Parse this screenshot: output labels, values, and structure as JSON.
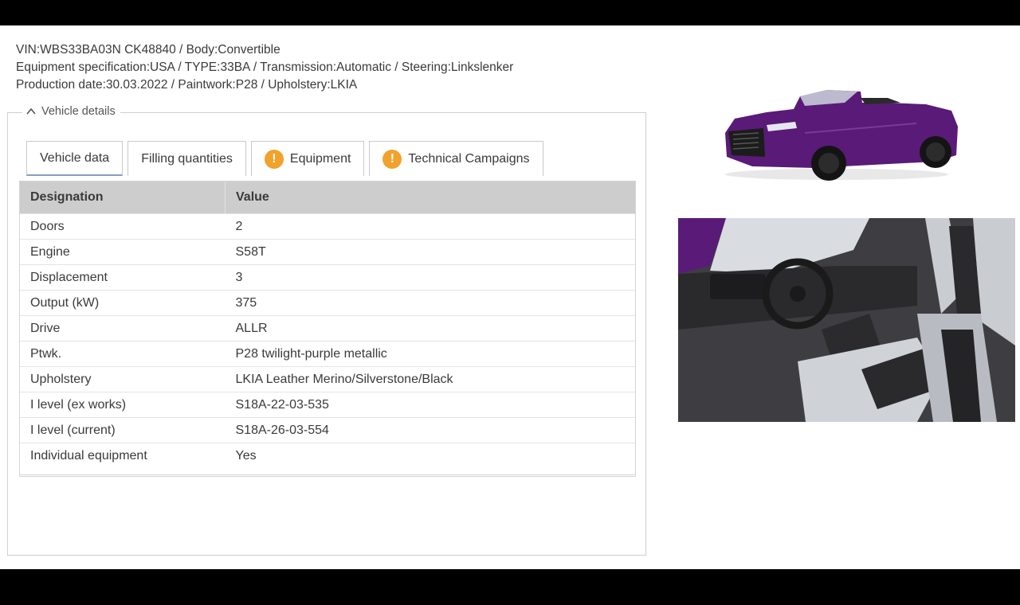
{
  "header": {
    "line1": "VIN:WBS33BA03N CK48840 / Body:Convertible",
    "line2": "Equipment specification:USA / TYPE:33BA / Transmission:Automatic / Steering:Linkslenker",
    "line3": "Production date:30.03.2022 / Paintwork:P28 / Upholstery:LKIA"
  },
  "section": {
    "title": "Vehicle details"
  },
  "tabs": [
    {
      "label": "Vehicle data",
      "warning": false,
      "active": true
    },
    {
      "label": "Filling quantities",
      "warning": false,
      "active": false
    },
    {
      "label": "Equipment",
      "warning": true,
      "active": false
    },
    {
      "label": "Technical Campaigns",
      "warning": true,
      "active": false
    }
  ],
  "table": {
    "headers": [
      "Designation",
      "Value"
    ],
    "rows": [
      [
        "Doors",
        "2"
      ],
      [
        "Engine",
        "S58T"
      ],
      [
        "Displacement",
        "3"
      ],
      [
        "Output (kW)",
        "375"
      ],
      [
        "Drive",
        "ALLR"
      ],
      [
        "Ptwk.",
        "P28 twilight-purple metallic"
      ],
      [
        "Upholstery",
        "LKIA Leather Merino/Silverstone/Black"
      ],
      [
        "I level (ex works)",
        "S18A-22-03-535"
      ],
      [
        "I level (current)",
        "S18A-26-03-554"
      ],
      [
        "Individual equipment",
        "Yes"
      ]
    ]
  },
  "colors": {
    "paintwork": "#5a1a78",
    "header_bg": "#cdcdcd",
    "warning": "#f2a12b",
    "active_tab_underline": "#8a9cc4"
  },
  "icons": {
    "collapse": "chevron-up-icon",
    "warning": "warning-icon"
  }
}
